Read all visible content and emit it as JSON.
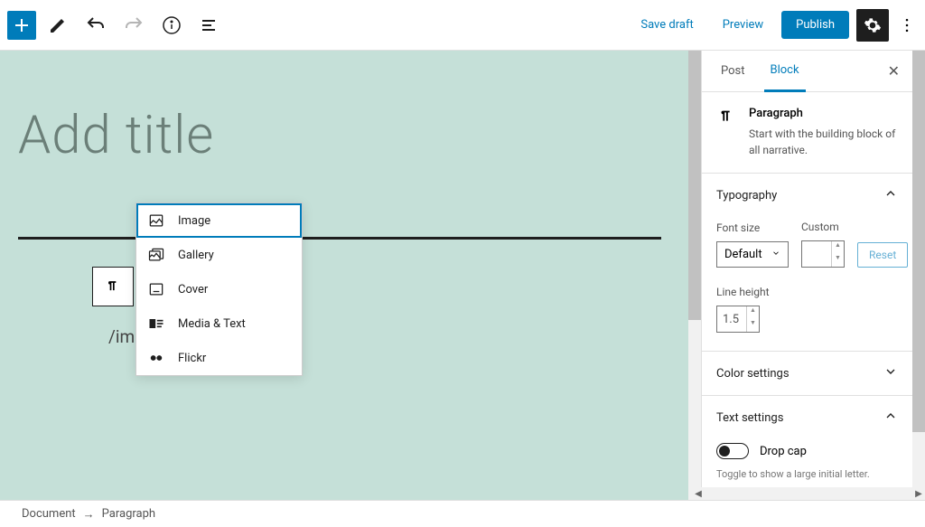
{
  "toolbar": {
    "save_draft": "Save draft",
    "preview": "Preview",
    "publish": "Publish"
  },
  "editor": {
    "title_placeholder": "Add title",
    "slash_text": "/image"
  },
  "autocomplete": {
    "items": [
      {
        "label": "Image",
        "icon": "image"
      },
      {
        "label": "Gallery",
        "icon": "gallery"
      },
      {
        "label": "Cover",
        "icon": "cover"
      },
      {
        "label": "Media & Text",
        "icon": "media-text"
      },
      {
        "label": "Flickr",
        "icon": "flickr"
      }
    ],
    "selected_index": 0
  },
  "sidebar": {
    "tabs": {
      "post": "Post",
      "block": "Block",
      "active": "block"
    },
    "block": {
      "name": "Paragraph",
      "description": "Start with the building block of all narrative."
    },
    "panels": {
      "typography": {
        "title": "Typography",
        "font_size_label": "Font size",
        "font_size_value": "Default",
        "custom_label": "Custom",
        "custom_value": "",
        "reset": "Reset",
        "line_height_label": "Line height",
        "line_height_value": "1.5"
      },
      "color": {
        "title": "Color settings"
      },
      "text": {
        "title": "Text settings",
        "drop_cap_label": "Drop cap",
        "drop_cap_enabled": false,
        "drop_cap_help": "Toggle to show a large initial letter."
      }
    }
  },
  "footer": {
    "breadcrumb": [
      "Document",
      "Paragraph"
    ]
  }
}
